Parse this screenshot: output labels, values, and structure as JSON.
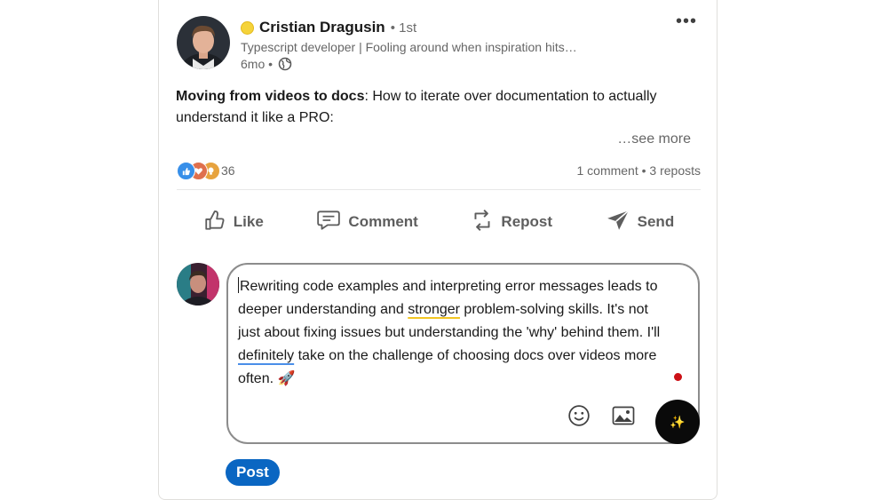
{
  "post": {
    "author": {
      "name": "Cristian Dragusin",
      "degree": "• 1st",
      "headline": "Typescript developer | Fooling around when inspiration hits…",
      "time": "6mo •"
    },
    "text": {
      "bold": "Moving from videos to docs",
      "rest": ": How to iterate over documentation to actually understand it like a PRO:"
    },
    "see_more": "…see more",
    "reactions_count": "36",
    "social_counts": "1 comment • 3 reposts"
  },
  "actions": {
    "like": "Like",
    "comment": "Comment",
    "repost": "Repost",
    "send": "Send"
  },
  "comment_box": {
    "segments": [
      "Rewriting code examples and interpreting error messages leads to deeper understanding and ",
      "stronger",
      " problem-solving skills. It's not just about fixing issues but understanding the 'why' behind them. I'll ",
      "definitely",
      " take on the challenge of choosing docs over videos more often. 🚀"
    ]
  },
  "post_button": "Post",
  "colors": {
    "primary": "#0a66c2",
    "status_dot": "#f5d33a",
    "notification_dot": "#cc1016"
  },
  "icons": {
    "reactions": [
      "like-reaction-icon",
      "love-reaction-icon",
      "insightful-reaction-icon"
    ],
    "emoji": "emoji-icon",
    "image": "image-icon",
    "ai": "sparkle-icon",
    "globe": "globe-icon",
    "more": "more-icon"
  }
}
